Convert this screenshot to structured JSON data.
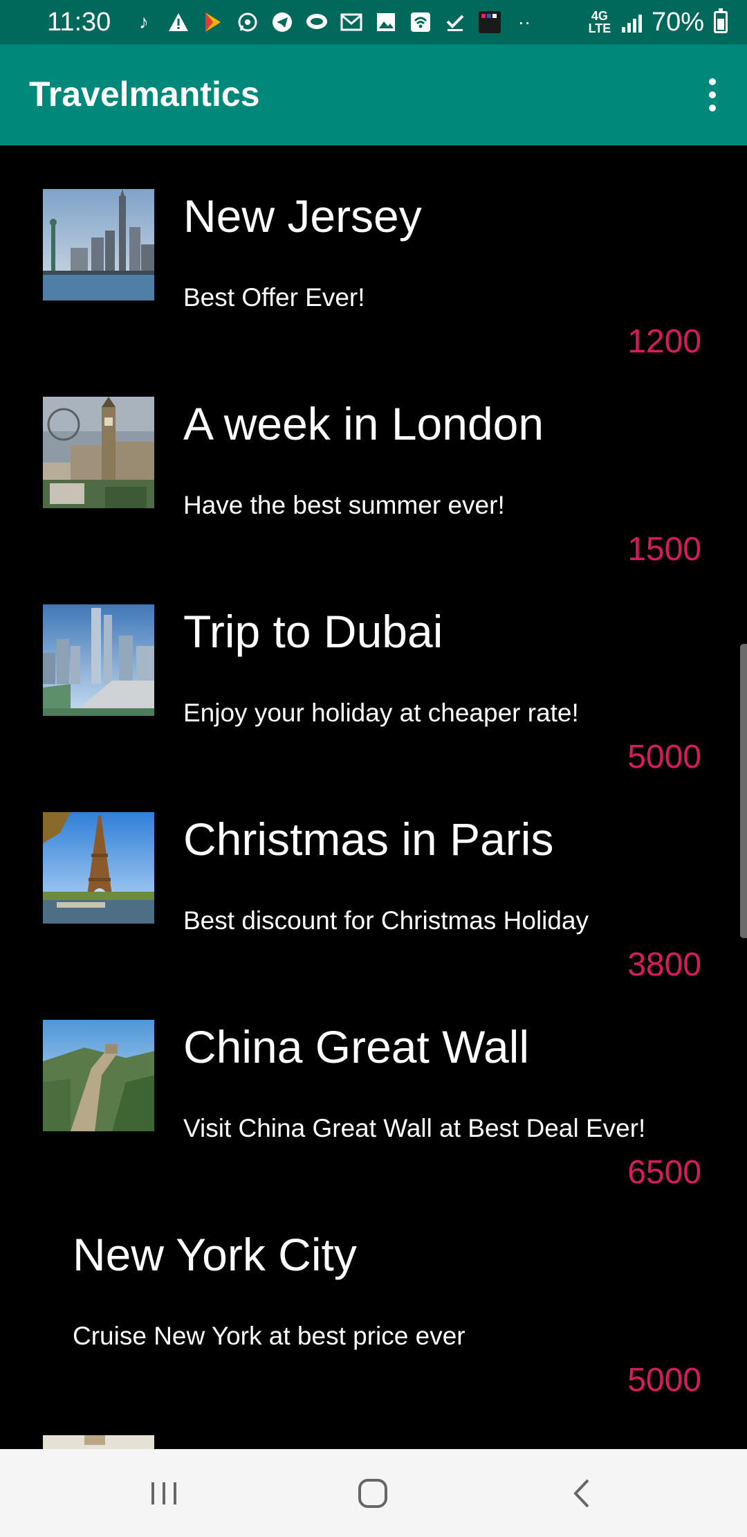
{
  "status_bar": {
    "time": "11:30",
    "network": "4G LTE",
    "battery": "70%",
    "icons": [
      "tiktok-icon",
      "alert-icon",
      "play-games-icon",
      "whatsapp-icon",
      "telegram-icon",
      "messages-icon",
      "gmail-icon",
      "gallery-icon",
      "wifi-calling-icon",
      "check-icon",
      "app-icon",
      "more-notifications-icon"
    ]
  },
  "app_bar": {
    "title": "Travelmantics",
    "menu_icon": "overflow-menu-icon"
  },
  "deals": [
    {
      "title": "New Jersey",
      "description": "Best Offer Ever!",
      "price": "1200",
      "image": "new-jersey-skyline"
    },
    {
      "title": "A week in London",
      "description": "Have the best summer ever!",
      "price": "1500",
      "image": "london-big-ben"
    },
    {
      "title": "Trip to Dubai",
      "description": "Enjoy your holiday at cheaper rate!",
      "price": "5000",
      "image": "dubai-towers"
    },
    {
      "title": "Christmas in Paris",
      "description": "Best discount for Christmas Holiday",
      "price": "3800",
      "image": "paris-eiffel-tower"
    },
    {
      "title": "China Great Wall",
      "description": "Visit China Great Wall at Best Deal Ever!",
      "price": "6500",
      "image": "great-wall"
    },
    {
      "title": "New York City",
      "description": "Cruise New York at best price ever",
      "price": "5000",
      "image": ""
    }
  ],
  "colors": {
    "status_bar": "#00695c",
    "app_bar": "#00897b",
    "background": "#000000",
    "price": "#d81b60",
    "nav_bar": "#f5f5f5"
  },
  "nav_bar": {
    "buttons": [
      "recent-apps-icon",
      "home-icon",
      "back-icon"
    ]
  }
}
